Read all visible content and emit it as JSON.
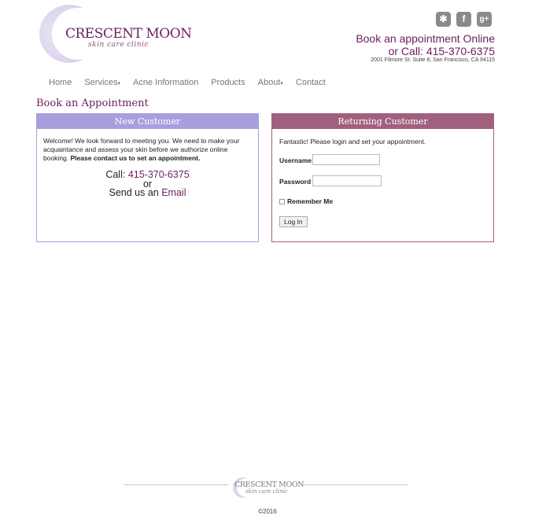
{
  "brand": {
    "name": "CRESCENT MOON",
    "tagline": "skin care clinic"
  },
  "social": [
    {
      "icon": "yelp-icon",
      "glyph": "✱"
    },
    {
      "icon": "facebook-icon",
      "glyph": "f"
    },
    {
      "icon": "google-plus-icon",
      "glyph": "g+"
    }
  ],
  "header": {
    "appt_online": "Book an appointment Online",
    "call_prefix": "or Call: ",
    "phone": "415-370-6375",
    "address": "2001 Filmore St. Suite 8, San Francisco, CA 94115"
  },
  "nav": [
    {
      "label": "Home",
      "caret": ""
    },
    {
      "label": "Services",
      "caret": "▾"
    },
    {
      "label": "Acne Information",
      "caret": ""
    },
    {
      "label": "Products",
      "caret": ""
    },
    {
      "label": "About",
      "caret": "▾"
    },
    {
      "label": "Contact",
      "caret": ""
    }
  ],
  "page_title": "Book an Appointment",
  "new_customer": {
    "heading": "New Customer",
    "welcome": "Welcome! We look forward to meeting you. We need to make your acquaintance and assess your skin before we authorize online booking.",
    "contact_note": "Please contact us to set an appointment.",
    "call_label": "Call: ",
    "phone": "415-370-6375",
    "or": "or",
    "send_label": "Send us an ",
    "email_link": "Email"
  },
  "returning_customer": {
    "heading": "Returning Customer",
    "intro": "Fantastic! Please login and set your appointment.",
    "username_label": "Username",
    "username_value": "",
    "password_label": "Password",
    "password_value": "",
    "remember_label": "Remember Me",
    "remember_checked": false,
    "login_button": "Log In"
  },
  "footer": {
    "brand_name": "CRESCENT MOON",
    "brand_tagline": "skin care clinic",
    "copyright": "©2016"
  },
  "colors": {
    "brand": "#6d1e5a",
    "new_customer_accent": "#a89fdc",
    "returning_customer_accent": "#a0607e"
  }
}
